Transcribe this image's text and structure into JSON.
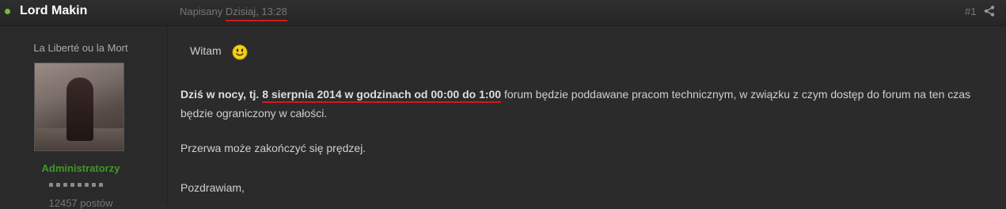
{
  "post": {
    "author": "Lord Makin",
    "posted_prefix": "Napisany",
    "posted_date": "Dzisiaj, 13:28",
    "post_number": "#1"
  },
  "profile": {
    "tagline": "La Liberté ou la Mort",
    "group": "Administratorzy",
    "post_count": "12457 postów",
    "rank_pips": 8
  },
  "body": {
    "greeting": "Witam",
    "intro_bold": "Dziś w nocy, tj.",
    "date_highlight": "8 sierpnia 2014 w godzinach od 00:00 do 1:00",
    "text_rest": "forum będzie poddawane pracom technicznym, w związku z czym dostęp do forum na ten czas będzie ograniczony w całości.",
    "line2": "Przerwa może zakończyć się prędzej.",
    "closing": "Pozdrawiam,"
  },
  "colors": {
    "background": "#2b2b2b",
    "author": "#ffffff",
    "group": "#3c9b24",
    "online": "#6fbf3b",
    "underline": "#d11a1a"
  },
  "icons": {
    "share": "share-icon",
    "smiley": "smiley-icon",
    "online": "online-status-icon"
  }
}
